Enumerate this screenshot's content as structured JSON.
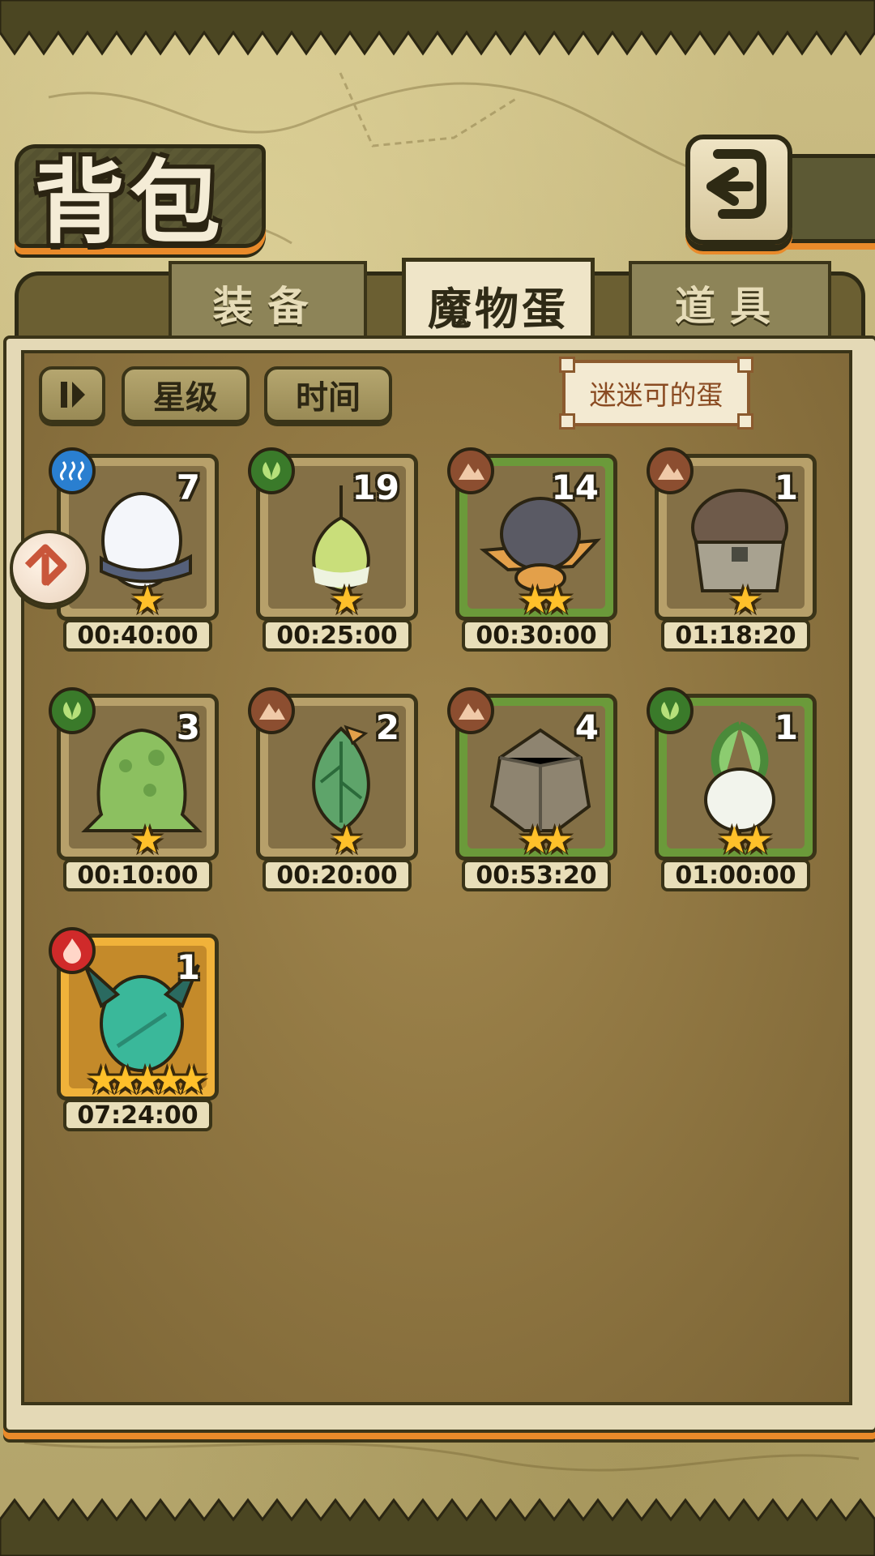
{
  "header": {
    "title": "背包"
  },
  "tabs": [
    {
      "label": "装备",
      "active": false
    },
    {
      "label": "魔物蛋",
      "active": true
    },
    {
      "label": "道具",
      "active": false
    }
  ],
  "filters": {
    "sort_icon": "pause-sort-icon",
    "star_label": "星级",
    "time_label": "时间"
  },
  "tooltip": {
    "text": "迷迷可的蛋"
  },
  "eggs": [
    {
      "element": "water",
      "count": "7",
      "stars": "★",
      "timer": "00:40:00",
      "frame": "plain"
    },
    {
      "element": "grass",
      "count": "19",
      "stars": "★",
      "timer": "00:25:00",
      "frame": "plain"
    },
    {
      "element": "earth",
      "count": "14",
      "stars": "★★",
      "timer": "00:30:00",
      "frame": "green"
    },
    {
      "element": "earth",
      "count": "1",
      "stars": "★",
      "timer": "01:18:20",
      "frame": "plain"
    },
    {
      "element": "grass",
      "count": "3",
      "stars": "★",
      "timer": "00:10:00",
      "frame": "plain"
    },
    {
      "element": "earth",
      "count": "2",
      "stars": "★",
      "timer": "00:20:00",
      "frame": "plain"
    },
    {
      "element": "earth",
      "count": "4",
      "stars": "★★",
      "timer": "00:53:20",
      "frame": "green"
    },
    {
      "element": "grass",
      "count": "1",
      "stars": "★★",
      "timer": "01:00:00",
      "frame": "green"
    },
    {
      "element": "fire",
      "count": "1",
      "stars": "★★★★★",
      "timer": "07:24:00",
      "frame": "gold"
    }
  ],
  "colors": {
    "accent_orange": "#e98a2a",
    "frame_dark": "#3a3418",
    "water": "#2a7fd0",
    "grass": "#3a7a2a",
    "earth": "#8c4e30",
    "fire": "#d02a2a"
  }
}
